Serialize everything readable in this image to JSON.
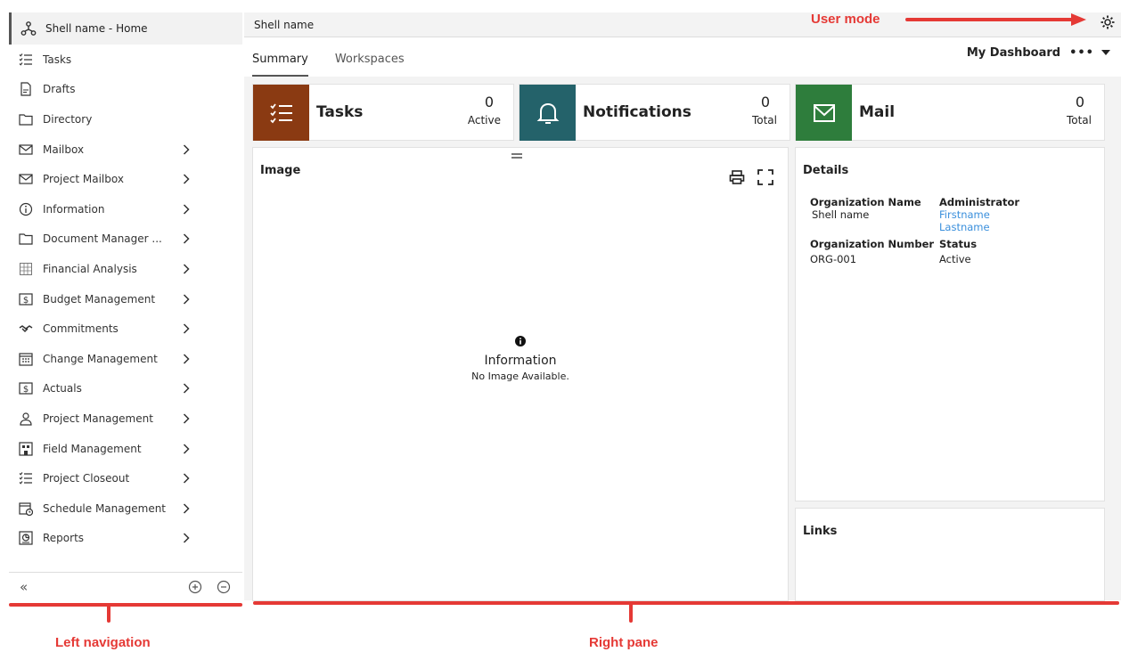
{
  "nav": {
    "home_label": "Shell name - Home",
    "items": [
      {
        "label": "Tasks",
        "icon": "tasks-icon",
        "chevron": false
      },
      {
        "label": "Drafts",
        "icon": "drafts-icon",
        "chevron": false
      },
      {
        "label": "Directory",
        "icon": "folder-icon",
        "chevron": false
      },
      {
        "label": "Mailbox",
        "icon": "mail-icon",
        "chevron": true
      },
      {
        "label": "Project Mailbox",
        "icon": "mail-icon",
        "chevron": true
      },
      {
        "label": "Information",
        "icon": "info-icon",
        "chevron": true
      },
      {
        "label": "Document Manager ...",
        "icon": "folder-icon",
        "chevron": true
      },
      {
        "label": "Financial Analysis",
        "icon": "grid-icon",
        "chevron": true
      },
      {
        "label": "Budget Management",
        "icon": "dollar-icon",
        "chevron": true
      },
      {
        "label": "Commitments",
        "icon": "handshake-icon",
        "chevron": true
      },
      {
        "label": "Change Management",
        "icon": "calendar-icon",
        "chevron": true
      },
      {
        "label": "Actuals",
        "icon": "dollar-icon",
        "chevron": true
      },
      {
        "label": "Project Management",
        "icon": "person-icon",
        "chevron": true
      },
      {
        "label": "Field Management",
        "icon": "building-icon",
        "chevron": true
      },
      {
        "label": "Project Closeout",
        "icon": "tasks-icon",
        "chevron": true
      },
      {
        "label": "Schedule Management",
        "icon": "schedule-icon",
        "chevron": true
      },
      {
        "label": "Reports",
        "icon": "reports-icon",
        "chevron": true
      }
    ],
    "collapse_symbol": "«"
  },
  "header": {
    "shell_name": "Shell name",
    "tabs": [
      {
        "label": "Summary",
        "active": true
      },
      {
        "label": "Workspaces",
        "active": false
      }
    ],
    "dashboard_label": "My Dashboard",
    "more_symbol": "•••"
  },
  "kpis": {
    "tasks": {
      "title": "Tasks",
      "value": "0",
      "caption": "Active",
      "color": "#8a3a12"
    },
    "notifications": {
      "title": "Notifications",
      "value": "0",
      "caption": "Total",
      "color": "#24626a"
    },
    "mail": {
      "title": "Mail",
      "value": "0",
      "caption": "Total",
      "color": "#2e7d3c"
    }
  },
  "image_card": {
    "title": "Image",
    "info_title": "Information",
    "info_text": "No Image Available."
  },
  "details": {
    "title": "Details",
    "org_name_label": "Organization Name",
    "org_name_value": "Shell name",
    "admin_label": "Administrator",
    "admin_first": "Firstname",
    "admin_last": "Lastname",
    "org_number_label": "Organization Number",
    "org_number_value": "ORG-001",
    "status_label": "Status",
    "status_value": "Active"
  },
  "links": {
    "title": "Links"
  },
  "annotations": {
    "user_mode": "User mode",
    "left_nav": "Left navigation",
    "right_pane": "Right pane",
    "color": "#e53935"
  }
}
